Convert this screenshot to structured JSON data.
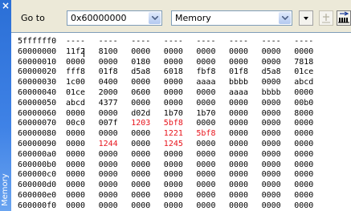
{
  "window": {
    "title": "Memory",
    "close_glyph": "×"
  },
  "toolbar": {
    "goto_label": "Go to",
    "address_value": "0x60000000",
    "view_type": "Memory",
    "icons": [
      "options-dropdown-icon",
      "add-watch-icon",
      "memory-layout-icon"
    ]
  },
  "colors": {
    "changed_value": "#e8141c",
    "title_strip": "#3f82e6"
  },
  "memory": {
    "rows": [
      {
        "address": "5ffffff0",
        "words": [
          "----",
          "----",
          "----",
          "----",
          "----",
          "----",
          "----",
          "----"
        ],
        "changed": []
      },
      {
        "address": "60000000",
        "words": [
          "11f2",
          "8100",
          "0000",
          "0000",
          "0000",
          "0000",
          "0000",
          "0000"
        ],
        "changed": []
      },
      {
        "address": "60000010",
        "words": [
          "0000",
          "0000",
          "0180",
          "0000",
          "0000",
          "0000",
          "0000",
          "7818"
        ],
        "changed": []
      },
      {
        "address": "60000020",
        "words": [
          "fff8",
          "01f8",
          "d5a8",
          "6018",
          "fbf8",
          "01f8",
          "d5a8",
          "01ce"
        ],
        "changed": []
      },
      {
        "address": "60000030",
        "words": [
          "1c00",
          "0400",
          "0000",
          "0000",
          "aaaa",
          "bbbb",
          "0000",
          "abcd"
        ],
        "changed": []
      },
      {
        "address": "60000040",
        "words": [
          "01ce",
          "2000",
          "0600",
          "0000",
          "0000",
          "aaaa",
          "bbbb",
          "0000"
        ],
        "changed": []
      },
      {
        "address": "60000050",
        "words": [
          "abcd",
          "4377",
          "0000",
          "0000",
          "0000",
          "0000",
          "0000",
          "00b0"
        ],
        "changed": []
      },
      {
        "address": "60000060",
        "words": [
          "0000",
          "0000",
          "d02d",
          "1b70",
          "1b70",
          "0000",
          "0000",
          "8000"
        ],
        "changed": []
      },
      {
        "address": "60000070",
        "words": [
          "00c0",
          "007f",
          "1203",
          "5bf8",
          "0000",
          "0000",
          "0000",
          "0000"
        ],
        "changed": [
          2,
          3
        ]
      },
      {
        "address": "60000080",
        "words": [
          "0000",
          "0000",
          "0000",
          "1221",
          "5bf8",
          "0000",
          "0000",
          "0000"
        ],
        "changed": [
          3,
          4
        ]
      },
      {
        "address": "60000090",
        "words": [
          "0000",
          "1244",
          "0000",
          "1245",
          "0000",
          "0000",
          "0000",
          "0000"
        ],
        "changed": [
          1,
          3
        ]
      },
      {
        "address": "600000a0",
        "words": [
          "0000",
          "0000",
          "0000",
          "0000",
          "0000",
          "0000",
          "0000",
          "0000"
        ],
        "changed": []
      },
      {
        "address": "600000b0",
        "words": [
          "0000",
          "0000",
          "0000",
          "0000",
          "0000",
          "0000",
          "0000",
          "0000"
        ],
        "changed": []
      },
      {
        "address": "600000c0",
        "words": [
          "0000",
          "0000",
          "0000",
          "0000",
          "0000",
          "0000",
          "0000",
          "0000"
        ],
        "changed": []
      },
      {
        "address": "600000d0",
        "words": [
          "0000",
          "0000",
          "0000",
          "0000",
          "0000",
          "0000",
          "0000",
          "0000"
        ],
        "changed": []
      },
      {
        "address": "600000e0",
        "words": [
          "0000",
          "0000",
          "0000",
          "0000",
          "0000",
          "0000",
          "0000",
          "0000"
        ],
        "changed": []
      },
      {
        "address": "600000f0",
        "words": [
          "0000",
          "0000",
          "0000",
          "0000",
          "0000",
          "0000",
          "0000",
          "0000"
        ],
        "changed": []
      }
    ]
  }
}
